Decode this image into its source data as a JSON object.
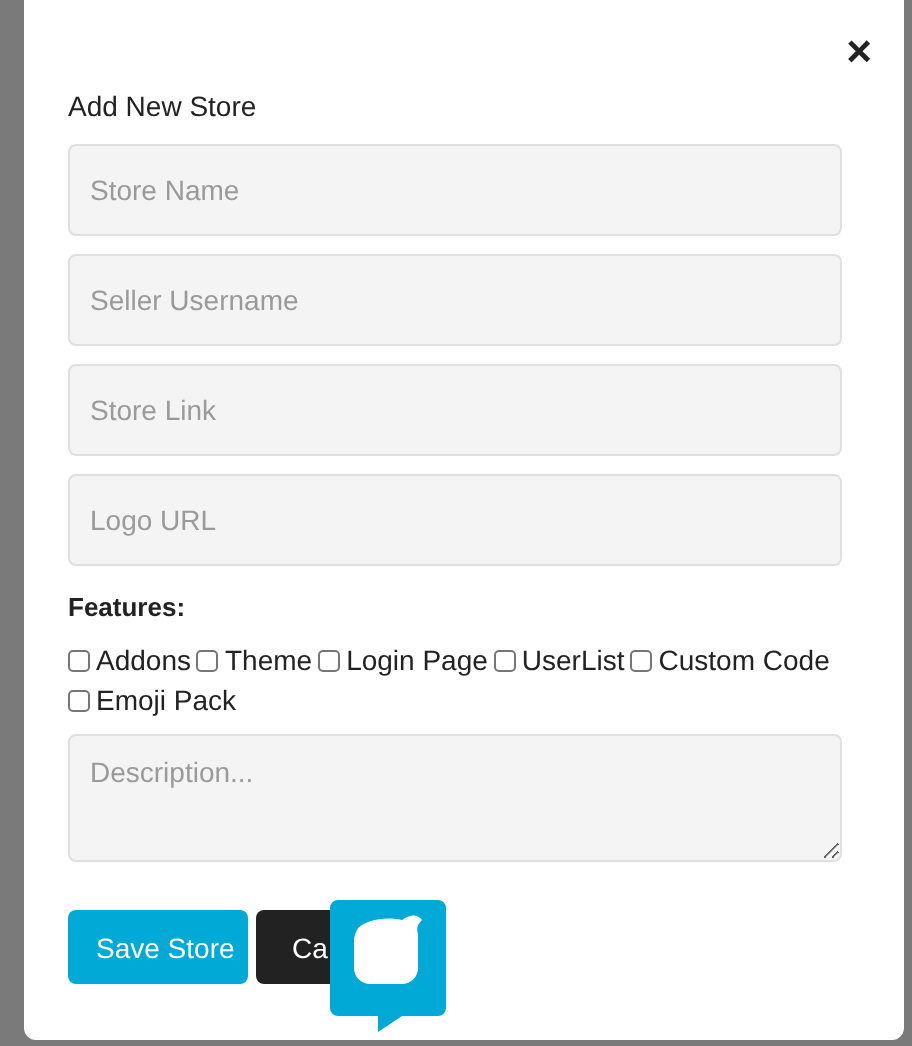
{
  "modal": {
    "title": "Add New Store",
    "close": "×"
  },
  "fields": [
    {
      "placeholder": "Store Name"
    },
    {
      "placeholder": "Seller Username"
    },
    {
      "placeholder": "Store Link"
    },
    {
      "placeholder": "Logo URL"
    }
  ],
  "features": {
    "label": "Features:",
    "options": [
      {
        "label": "Addons",
        "checked": false
      },
      {
        "label": "Theme",
        "checked": false
      },
      {
        "label": "Login Page",
        "checked": false
      },
      {
        "label": "UserList",
        "checked": false
      },
      {
        "label": "Custom Code",
        "checked": false
      },
      {
        "label": "Emoji Pack",
        "checked": false
      }
    ]
  },
  "description": {
    "placeholder": "Description..."
  },
  "buttons": [
    {
      "label": "Save Store",
      "kind": "primary"
    },
    {
      "label": "Ca",
      "kind": "dark"
    }
  ]
}
